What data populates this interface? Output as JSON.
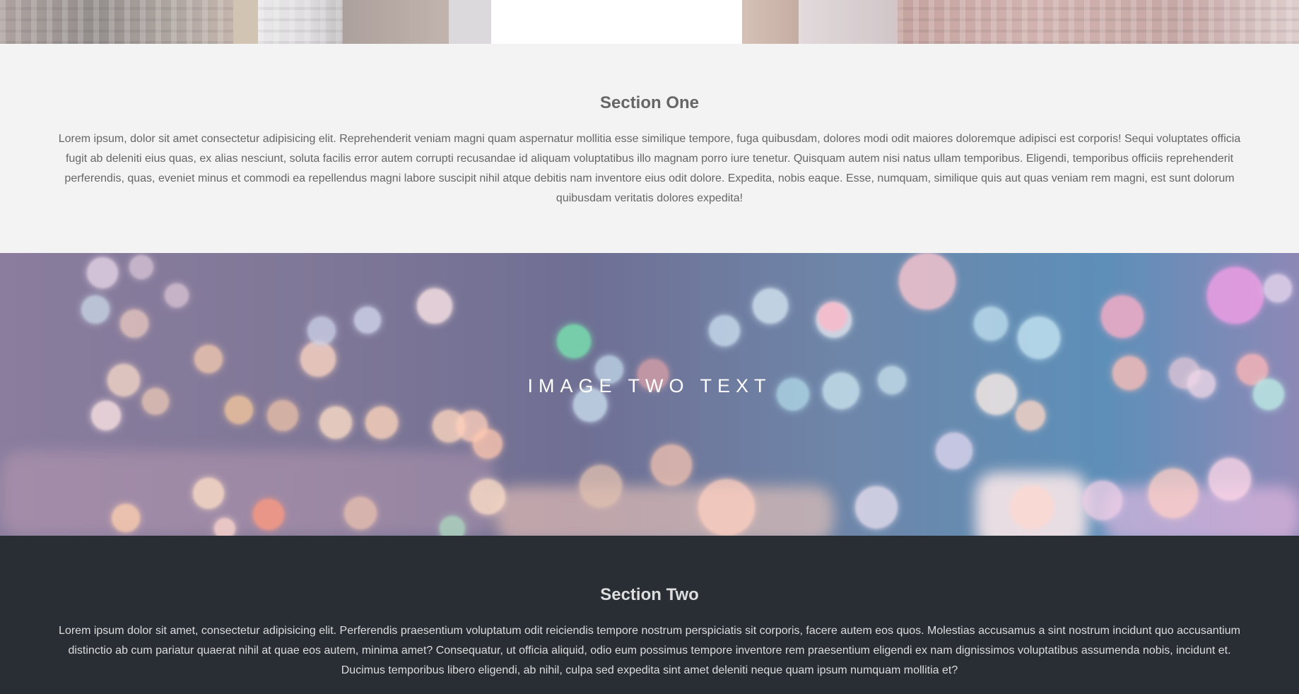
{
  "section_one": {
    "heading": "Section One",
    "body": "Lorem ipsum, dolor sit amet consectetur adipisicing elit. Reprehenderit veniam magni quam aspernatur mollitia esse similique tempore, fuga quibusdam, dolores modi odit maiores doloremque adipisci est corporis! Sequi voluptates officia fugit ab deleniti eius quas, ex alias nesciunt, soluta facilis error autem corrupti recusandae id aliquam voluptatibus illo magnam porro iure tenetur. Quisquam autem nisi natus ullam temporibus. Eligendi, temporibus officiis reprehenderit perferendis, quas, eveniet minus et commodi ea repellendus magni labore suscipit nihil atque debitis nam inventore eius odit dolore. Expedita, nobis eaque. Esse, numquam, similique quis aut quas veniam rem magni, est sunt dolorum quibusdam veritatis dolores expedita!"
  },
  "image_two": {
    "caption": "IMAGE TWO TEXT"
  },
  "section_two": {
    "heading": "Section Two",
    "body": "Lorem ipsum dolor sit amet, consectetur adipisicing elit. Perferendis praesentium voluptatum odit reiciendis tempore nostrum perspiciatis sit corporis, facere autem eos quos. Molestias accusamus a sint nostrum incidunt quo accusantium distinctio ab cum pariatur quaerat nihil at quae eos autem, minima amet? Consequatur, ut officia aliquid, odio eum possimus tempore inventore rem praesentium eligendi ex nam dignissimos voluptatibus assumenda nobis, incidunt et. Ducimus temporibus libero eligendi, ab nihil, culpa sed expedita sint amet deleniti neque quam ipsum numquam mollitia et?"
  },
  "colors": {
    "section_one_bg": "#f3f3f3",
    "section_one_text": "#666666",
    "section_two_bg": "#282e34",
    "section_two_text": "#dddddd",
    "caption_text": "#ffffff"
  }
}
